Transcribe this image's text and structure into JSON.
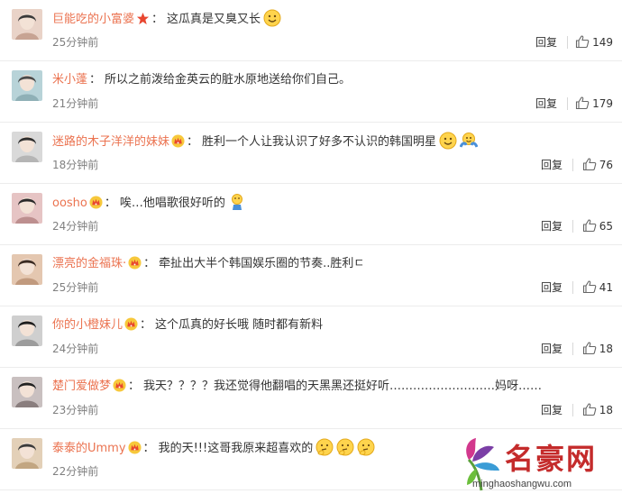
{
  "comments": [
    {
      "user": "巨能吃的小富婆",
      "badge": "star",
      "text": "这瓜真是又臭又长",
      "emoji": [
        "smile"
      ],
      "time": "25分钟前",
      "reply": "回复",
      "likes": "149"
    },
    {
      "user": "米小蓬",
      "badge": "none",
      "text": "所以之前泼给金英云的脏水原地送给你们自己。",
      "emoji": [],
      "time": "21分钟前",
      "reply": "回复",
      "likes": "179"
    },
    {
      "user": "迷路的木子洋洋的妹妹",
      "badge": "crown",
      "text": "胜利一个人让我认识了好多不认识的韩国明星",
      "emoji": [
        "smile",
        "hug"
      ],
      "time": "18分钟前",
      "reply": "回复",
      "likes": "76"
    },
    {
      "user": "oosho",
      "badge": "crown",
      "text": "唉…他唱歌很好听的",
      "emoji": [
        "sad"
      ],
      "time": "24分钟前",
      "reply": "回复",
      "likes": "65"
    },
    {
      "user": "漂亮的金福珠·",
      "badge": "crown",
      "text": "牵扯出大半个韩国娱乐圈的节奏..胜利ㄷ",
      "emoji": [],
      "time": "25分钟前",
      "reply": "回复",
      "likes": "41"
    },
    {
      "user": "你的小橙妹儿",
      "badge": "crown",
      "text": "这个瓜真的好长哦 随时都有新料",
      "emoji": [],
      "time": "24分钟前",
      "reply": "回复",
      "likes": "18"
    },
    {
      "user": "楚门爱做梦",
      "badge": "crown",
      "text": "我天？？？？我还觉得他翻唱的天黑黑还挺好听………………………妈呀……",
      "emoji": [],
      "time": "23分钟前",
      "reply": "回复",
      "likes": "18"
    },
    {
      "user": "泰泰的Ummy",
      "badge": "crown",
      "text": "我的天!!!这哥我原来超喜欢的",
      "emoji": [
        "think",
        "think",
        "think"
      ],
      "time": "22分钟前",
      "reply": "回复",
      "likes": ""
    }
  ],
  "watermark": {
    "name": "名豪网",
    "url": "minghaoshangwu.com"
  },
  "colors": {
    "username": "#eb7350",
    "brand_red": "#c42b2b"
  }
}
